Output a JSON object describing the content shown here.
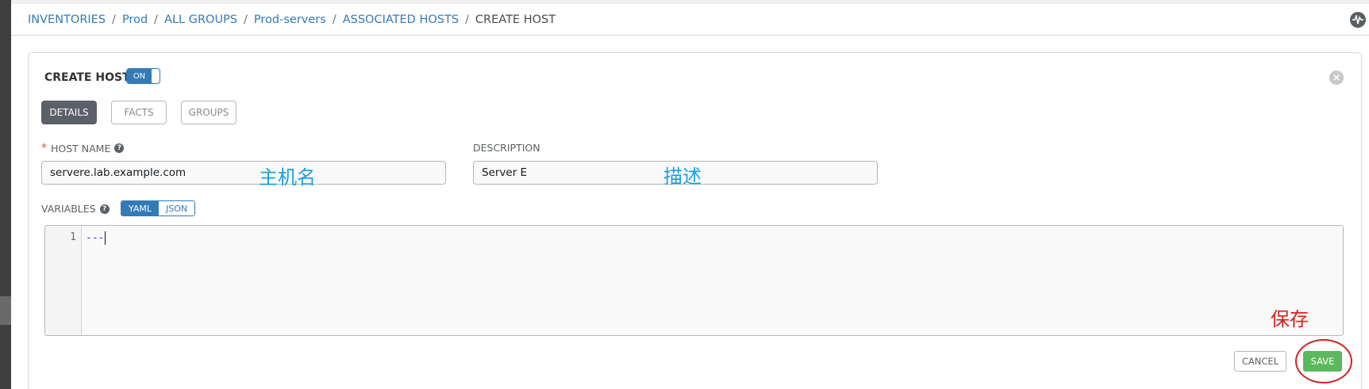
{
  "breadcrumb": {
    "items": [
      "INVENTORIES",
      "Prod",
      "ALL GROUPS",
      "Prod-servers",
      "ASSOCIATED HOSTS"
    ],
    "current": "CREATE HOST",
    "separator": "/"
  },
  "header": {
    "activity_icon": "activity-stream-icon"
  },
  "form": {
    "title": "CREATE HOST",
    "toggle_label": "ON",
    "close_icon": "×",
    "tabs": [
      {
        "label": "DETAILS",
        "active": true
      },
      {
        "label": "FACTS",
        "active": false
      },
      {
        "label": "GROUPS",
        "active": false
      }
    ],
    "host_name": {
      "required_mark": "*",
      "label": "HOST NAME",
      "value": "servere.lab.example.com"
    },
    "description": {
      "label": "DESCRIPTION",
      "value": "Server E"
    },
    "variables": {
      "label": "VARIABLES",
      "formats": [
        {
          "label": "YAML",
          "active": true
        },
        {
          "label": "JSON",
          "active": false
        }
      ],
      "line_number": "1",
      "content": "---"
    },
    "help_icon": "?",
    "cancel_label": "CANCEL",
    "save_label": "SAVE"
  },
  "annotations": {
    "host_name_note": "主机名",
    "description_note": "描述",
    "save_note": "保存"
  },
  "colors": {
    "link": "#337ab7",
    "active_tab": "#5c6069",
    "save": "#5cb85c",
    "annotation_blue": "#1aa0e0",
    "annotation_red": "#d42020"
  }
}
